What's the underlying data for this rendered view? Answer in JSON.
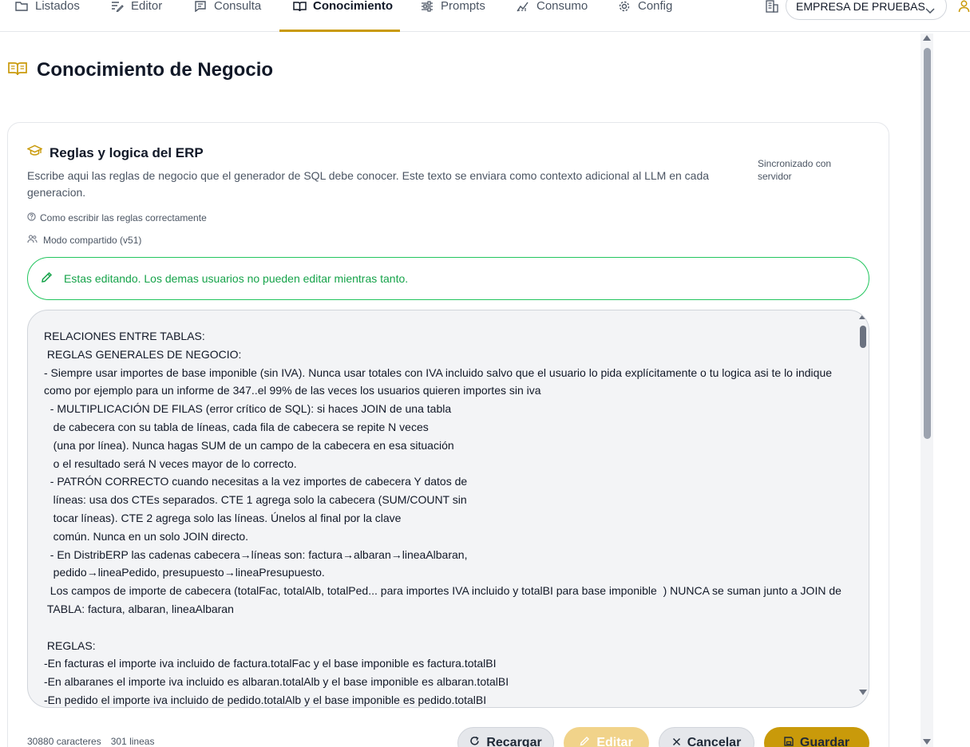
{
  "nav": {
    "tabs": [
      {
        "label": "Listados",
        "icon": "folder-icon"
      },
      {
        "label": "Editor",
        "icon": "edit-list-icon"
      },
      {
        "label": "Consulta",
        "icon": "message-square-icon"
      },
      {
        "label": "Conocimiento",
        "icon": "book-open-icon",
        "active": true
      },
      {
        "label": "Prompts",
        "icon": "sliders-icon"
      },
      {
        "label": "Consumo",
        "icon": "chart-line-icon"
      },
      {
        "label": "Config",
        "icon": "gear-icon"
      }
    ],
    "company_selected": "EMPRESA DE PRUEBAS"
  },
  "page": {
    "title": "Conocimiento de Negocio"
  },
  "card": {
    "title": "Reglas y logica del ERP",
    "description": "Escribe aqui las reglas de negocio que el generador de SQL debe conocer. Este texto se enviara como contexto adicional al LLM en cada generacion.",
    "sync_status": "Sincronizado con servidor",
    "help_link": "Como escribir las reglas correctamente",
    "mode": "Modo compartido (v51)",
    "edit_banner": "Estas editando. Los demas usuarios no pueden editar mientras tanto.",
    "editor_content": "RELACIONES ENTRE TABLAS:\n REGLAS GENERALES DE NEGOCIO:\n- Siempre usar importes de base imponible (sin IVA). Nunca usar totales con IVA incluido salvo que el usuario lo pida explícitamente o tu logica asi te lo indique como por ejemplo para un informe de 347..el 99% de las veces los usuarios quieren importes sin iva\n  - MULTIPLICACIÓN DE FILAS (error crítico de SQL): si haces JOIN de una tabla\n   de cabecera con su tabla de líneas, cada fila de cabecera se repite N veces\n   (una por línea). Nunca hagas SUM de un campo de la cabecera en esa situación\n   o el resultado será N veces mayor de lo correcto.\n  - PATRÓN CORRECTO cuando necesitas a la vez importes de cabecera Y datos de\n   líneas: usa dos CTEs separados. CTE 1 agrega solo la cabecera (SUM/COUNT sin\n   tocar líneas). CTE 2 agrega solo las líneas. Únelos al final por la clave\n   común. Nunca en un solo JOIN directo.\n  - En DistribERP las cadenas cabecera→líneas son: factura→albaran→lineaAlbaran,\n   pedido→lineaPedido, presupuesto→lineaPresupuesto.\n  Los campos de importe de cabecera (totalFac, totalAlb, totalPed... para importes IVA incluido y totalBI para base imponible  ) NUNCA se suman junto a JOIN de\n TABLA: factura, albaran, lineaAlbaran\n\n REGLAS:\n-En facturas el importe iva incluido de factura.totalFac y el base imponible es factura.totalBI\n-En albaranes el importe iva incluido es albaran.totalAlb y el base imponible es albaran.totalBI\n-En pedido el importe iva incluido de pedido.totalAlb y el base imponible es pedido.totalBI",
    "char_count": "30880 caracteres",
    "line_count": "301 lineas"
  },
  "buttons": {
    "reload": "Recargar",
    "edit": "Editar",
    "cancel": "Cancelar",
    "save": "Guardar"
  },
  "colors": {
    "accent": "#c99a0a",
    "success": "#16a34a",
    "success_border": "#22c55e",
    "edit_disabled": "#f1d38a"
  }
}
